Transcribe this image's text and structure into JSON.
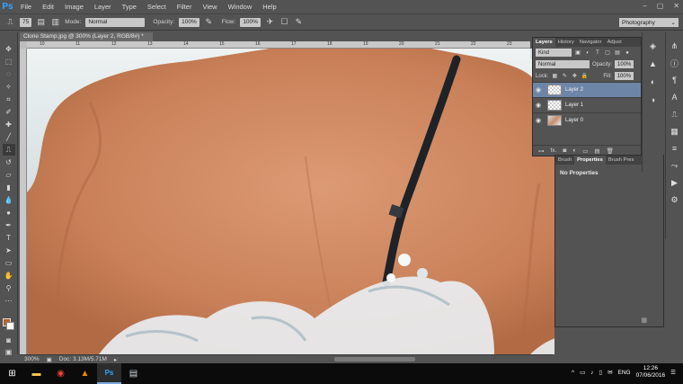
{
  "app": {
    "logo": "Ps"
  },
  "menu": [
    "File",
    "Edit",
    "Image",
    "Layer",
    "Type",
    "Select",
    "Filter",
    "View",
    "Window",
    "Help"
  ],
  "window_controls": [
    "–",
    "▢",
    "✕"
  ],
  "options": {
    "brush_size": "75",
    "mode_label": "Mode:",
    "mode_value": "Normal",
    "opacity_label": "Opacity:",
    "opacity_value": "100%",
    "flow_label": "Flow:",
    "flow_value": "100%",
    "workspace": "Photography"
  },
  "document": {
    "tab_title": "Clone Stamp.jpg @ 300% (Layer 2, RGB/8#) *",
    "ruler_ticks": [
      "10",
      "11",
      "12",
      "13",
      "14",
      "15",
      "16",
      "17",
      "18",
      "19",
      "20",
      "21",
      "22",
      "23"
    ],
    "zoom": "300%",
    "doc_info": "Doc: 3.13M/5.71M"
  },
  "layers_panel": {
    "tabs": [
      "Layers",
      "History",
      "Navigator",
      "Adjust"
    ],
    "kind_label": "Kind",
    "blend_mode": "Normal",
    "opacity_label": "Opacity:",
    "opacity_value": "100%",
    "lock_label": "Lock:",
    "fill_label": "Fill:",
    "fill_value": "100%",
    "layers": [
      {
        "name": "Layer 2",
        "thumb": "transparent",
        "selected": true
      },
      {
        "name": "Layer 1",
        "thumb": "transparent",
        "selected": false
      },
      {
        "name": "Layer 0",
        "thumb": "photo",
        "selected": false
      }
    ],
    "footer_icons": [
      "link-icon",
      "fx-icon",
      "mask-icon",
      "adjustment-icon",
      "folder-icon",
      "new-layer-icon",
      "trash-icon"
    ],
    "footer_fx": "fx."
  },
  "properties_panel": {
    "tabs": [
      "Brush",
      "Properties",
      "Brush Pres"
    ],
    "body": "No Properties"
  },
  "taskbar": {
    "language": "ENG",
    "time": "12:26",
    "date": "07/06/2016"
  },
  "colors": {
    "foreground": "#b8612d",
    "background": "#ffffff",
    "ui_bg": "#535353",
    "selected_layer": "#6d86a8",
    "brand": "#31a8ff"
  }
}
